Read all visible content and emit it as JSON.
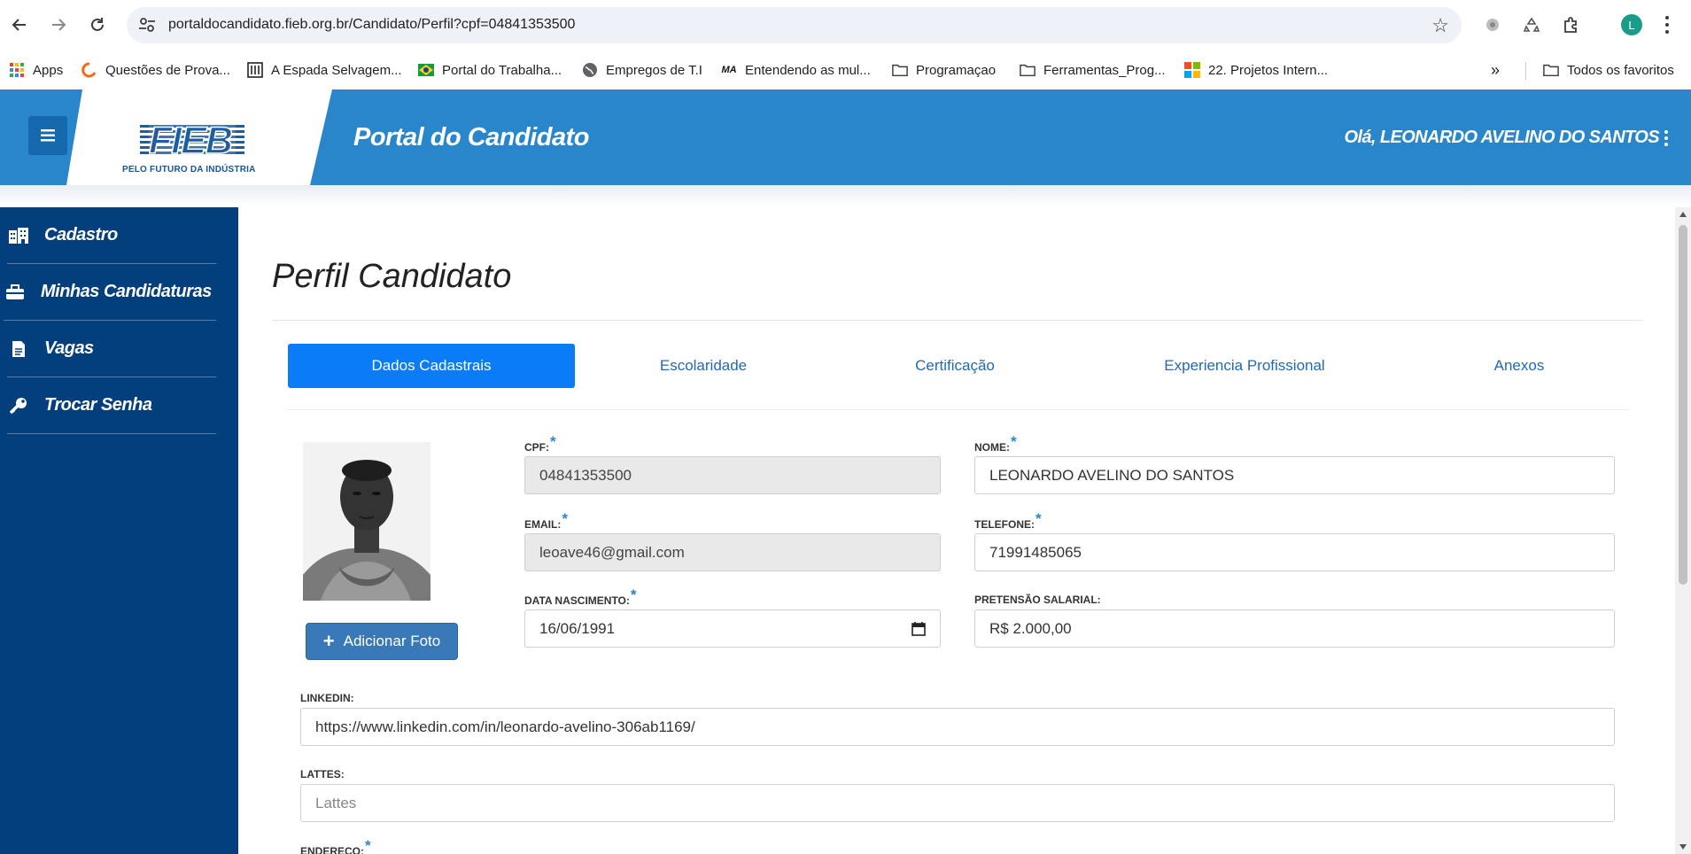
{
  "browser": {
    "url": "portaldocandidato.fieb.org.br/Candidato/Perfil?cpf=04841353500",
    "avatar_letter": "L",
    "bookmarks": [
      {
        "label": "Apps",
        "icon": "apps-grid-icon"
      },
      {
        "label": "Questões de Prova...",
        "icon": "questoes-logo-icon"
      },
      {
        "label": "A Espada Selvagem...",
        "icon": "building-icon"
      },
      {
        "label": "Portal do Trabalha...",
        "icon": "brazil-flag-icon"
      },
      {
        "label": "Empregos de T.I",
        "icon": "globe-icon"
      },
      {
        "label": "Entendendo as mul...",
        "icon": "ma-logo-icon"
      },
      {
        "label": "Programaçao",
        "icon": "folder-icon"
      },
      {
        "label": "Ferramentas_Prog...",
        "icon": "folder-icon"
      },
      {
        "label": "22. Projetos Intern...",
        "icon": "microsoft-logo-icon"
      }
    ],
    "all_bookmarks_label": "Todos os favoritos"
  },
  "header": {
    "logo_text": "FIEB",
    "logo_tagline": "PELO FUTURO DA INDÚSTRIA",
    "portal_title": "Portal do Candidato",
    "greeting": "Olá, LEONARDO AVELINO DO SANTOS",
    "brand_color": "#2a86cb"
  },
  "sidebar": {
    "items": [
      {
        "label": "Cadastro",
        "icon": "building-icon"
      },
      {
        "label": "Minhas Candidaturas",
        "icon": "briefcase-icon"
      },
      {
        "label": "Vagas",
        "icon": "document-icon"
      },
      {
        "label": "Trocar Senha",
        "icon": "key-icon"
      }
    ]
  },
  "main": {
    "title": "Perfil Candidato",
    "tabs": [
      {
        "label": "Dados Cadastrais",
        "active": true
      },
      {
        "label": "Escolaridade",
        "active": false
      },
      {
        "label": "Certificação",
        "active": false
      },
      {
        "label": "Experiencia Profissional",
        "active": false
      },
      {
        "label": "Anexos",
        "active": false
      }
    ],
    "add_photo_label": "Adicionar Foto",
    "fields": {
      "cpf": {
        "label": "CPF:",
        "value": "04841353500",
        "required": true
      },
      "nome": {
        "label": "NOME:",
        "value": "LEONARDO AVELINO DO SANTOS",
        "required": true
      },
      "email": {
        "label": "EMAIL:",
        "value": "leoave46@gmail.com",
        "required": true
      },
      "telefone": {
        "label": "TELEFONE:",
        "value": "71991485065",
        "required": true
      },
      "data_nascimento": {
        "label": "DATA NASCIMENTO:",
        "value": "16/06/1991",
        "required": true
      },
      "pretensao_salarial": {
        "label": "PRETENSÃO SALARIAL:",
        "value": "R$ 2.000,00",
        "required": false
      },
      "linkedin": {
        "label": "LINKEDIN:",
        "value": "https://www.linkedin.com/in/leonardo-avelino-306ab1169/",
        "required": false
      },
      "lattes": {
        "label": "LATTES:",
        "value": "",
        "placeholder": "Lattes",
        "required": false
      },
      "endereco": {
        "label": "ENDERECO:",
        "required": true
      }
    },
    "required_marker": "*"
  }
}
